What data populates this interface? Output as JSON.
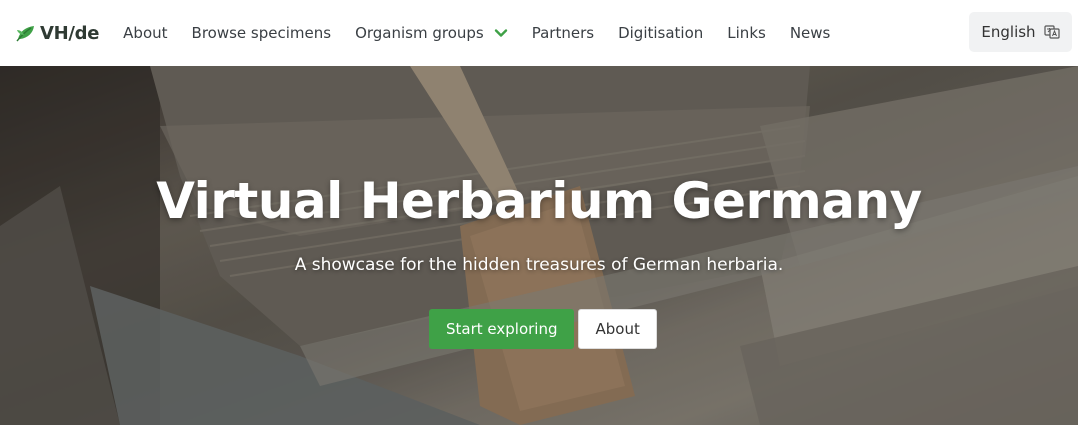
{
  "brand": {
    "name": "VH/de",
    "icon": "leaf-icon",
    "color": "#3fa147"
  },
  "nav": {
    "items": [
      {
        "label": "About"
      },
      {
        "label": "Browse specimens"
      },
      {
        "label": "Organism groups",
        "dropdown": true
      },
      {
        "label": "Partners"
      },
      {
        "label": "Digitisation"
      },
      {
        "label": "Links"
      },
      {
        "label": "News"
      }
    ],
    "language": {
      "label": "English",
      "icon": "translate-icon"
    }
  },
  "hero": {
    "title": "Virtual Herbarium Germany",
    "subtitle": "A showcase for the hidden treasures of German herbaria.",
    "primary_button": "Start exploring",
    "secondary_button": "About",
    "accent": "#3fa147"
  }
}
